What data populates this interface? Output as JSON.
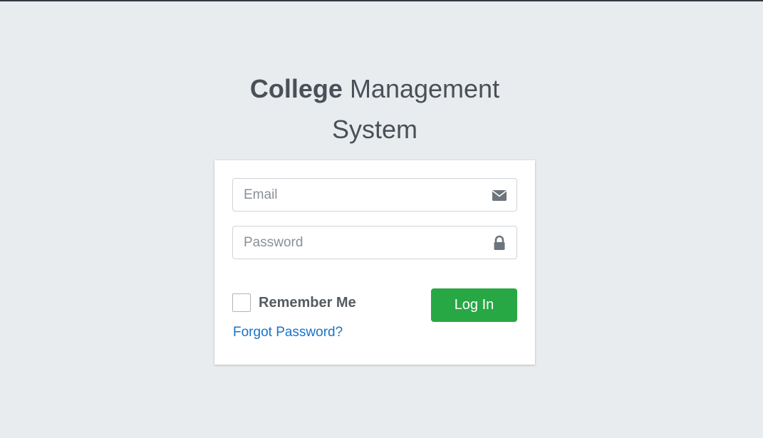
{
  "logo": {
    "bold": "College",
    "rest": " Management System"
  },
  "login": {
    "email_placeholder": "Email",
    "email_icon": "envelope-icon",
    "password_placeholder": "Password",
    "password_icon": "lock-icon",
    "remember_label": "Remember Me",
    "remember_checked": false,
    "login_button": "Log In",
    "forgot_link": "Forgot Password?"
  },
  "colors": {
    "background": "#e9ecef",
    "button": "#28a745",
    "link": "#1a73c8"
  }
}
